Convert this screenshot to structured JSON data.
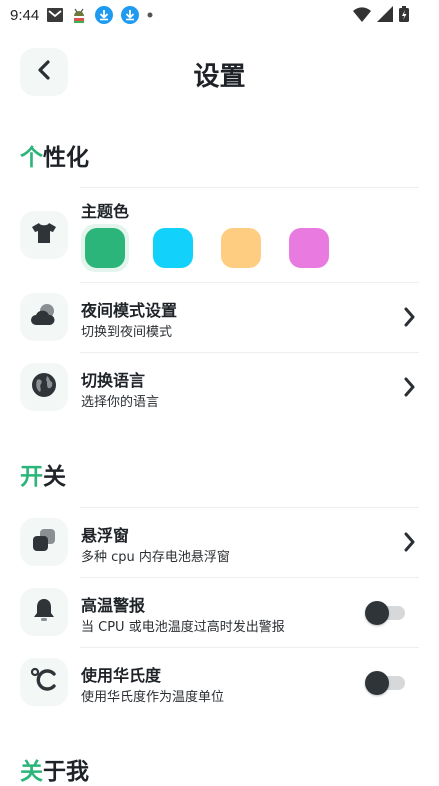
{
  "status_bar": {
    "time": "9:44",
    "icons": [
      "gmail-icon",
      "android-icon",
      "download-icon",
      "download-icon",
      "dot-icon"
    ],
    "right_icons": [
      "wifi-icon",
      "signal-icon",
      "battery-icon"
    ]
  },
  "header": {
    "title": "设置",
    "back_icon": "chevron-left-icon"
  },
  "sections": {
    "personalize": {
      "accent": "个",
      "rest": "性化"
    },
    "switches": {
      "accent": "开",
      "rest": "关"
    },
    "about": {
      "accent": "关",
      "rest": "于我"
    }
  },
  "theme": {
    "label": "主题色",
    "icon": "tshirt-icon",
    "colors": [
      "#2cb57a",
      "#12d2fb",
      "#ffcd82",
      "#e87ae0"
    ],
    "selected_index": 0
  },
  "night_mode": {
    "title": "夜间模式设置",
    "subtitle": "切换到夜间模式",
    "icon": "cloud-moon-icon"
  },
  "language": {
    "title": "切换语言",
    "subtitle": "选择你的语言",
    "icon": "globe-icon"
  },
  "float_window": {
    "title": "悬浮窗",
    "subtitle": "多种 cpu 内存电池悬浮窗",
    "icon": "layers-icon"
  },
  "temp_alarm": {
    "title": "高温警报",
    "subtitle": "当 CPU 或电池温度过高时发出警报",
    "icon": "bell-icon",
    "enabled": false
  },
  "fahrenheit": {
    "title": "使用华氏度",
    "subtitle": "使用华氏度作为温度单位",
    "icon": "celsius-icon",
    "enabled": false
  },
  "colors": {
    "accent": "#2cb57a",
    "icon_bg": "#f3f7f6",
    "text": "#1f2328"
  }
}
